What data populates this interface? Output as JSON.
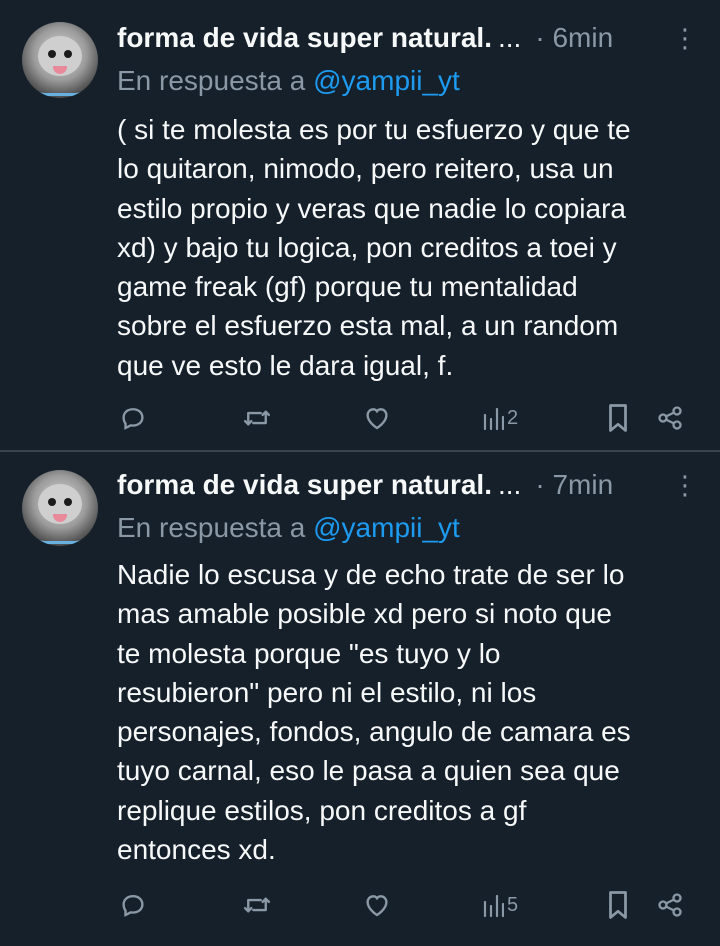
{
  "tweets": [
    {
      "author_name": "forma de vida super natural.",
      "name_ellipsis": "...",
      "time": "· 6min",
      "reply_prefix": "En respuesta a",
      "reply_handle": "@yampii_yt",
      "text_lines": [
        "( si te molesta es por tu esfuerzo y que te",
        "lo quitaron, nimodo, pero reitero, usa un",
        "estilo propio y veras que nadie lo copiara",
        "xd) y bajo tu logica, pon creditos a toei y",
        "game freak (gf) porque tu mentalidad",
        "sobre el esfuerzo esta mal, a un random",
        "que ve esto le dara igual, f."
      ],
      "views": "2"
    },
    {
      "author_name": "forma de vida super natural.",
      "name_ellipsis": "...",
      "time": "· 7min",
      "reply_prefix": "En respuesta a",
      "reply_handle": "@yampii_yt",
      "text_lines": [
        "Nadie lo escusa y de echo trate de ser lo",
        "mas amable posible xd pero si noto que",
        "te molesta porque \"es tuyo y lo",
        "resubieron\" pero ni el estilo, ni los",
        "personajes, fondos, angulo de camara es",
        "tuyo carnal, eso le pasa a quien sea que",
        "replique estilos, pon creditos a gf",
        "entonces xd."
      ],
      "views": "5"
    }
  ],
  "icons": {
    "more": "more-vertical-icon",
    "reply": "reply-icon",
    "retweet": "retweet-icon",
    "like": "like-heart-icon",
    "views": "views-chart-icon",
    "bookmark": "bookmark-icon",
    "share": "share-icon"
  },
  "colors": {
    "background": "#15202b",
    "text": "#f7f9f9",
    "secondary": "#8b98a5",
    "link": "#1d9bf0",
    "divider": "#38444d"
  }
}
